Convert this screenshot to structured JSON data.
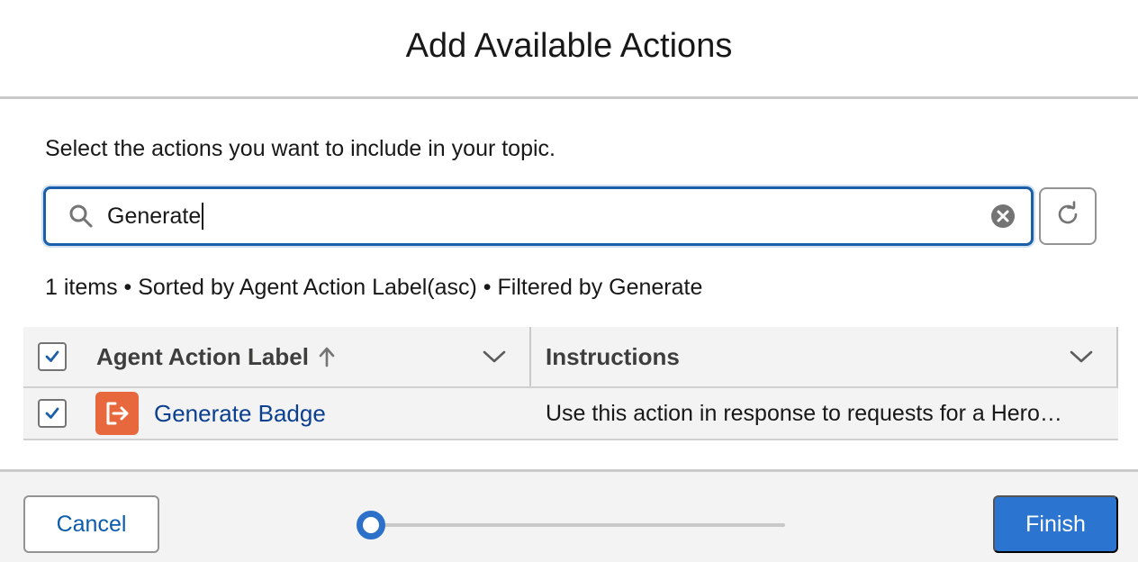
{
  "modal": {
    "title": "Add Available Actions",
    "intro": "Select the actions you want to include in your topic."
  },
  "search": {
    "value": "Generate",
    "placeholder": "Search"
  },
  "summary": "1 items • Sorted by Agent Action Label(asc) • Filtered by Generate",
  "table": {
    "columns": [
      "Agent Action Label",
      "Instructions"
    ],
    "select_all_checked": true,
    "rows": [
      {
        "label": "Generate Badge",
        "instructions": "Use this action in response to requests for a Hero…",
        "checked": true,
        "icon": "exit-arrow-icon",
        "icon_color": "#e8683e"
      }
    ]
  },
  "footer": {
    "cancel_label": "Cancel",
    "finish_label": "Finish",
    "progress_fraction": 0.0
  },
  "colors": {
    "accent": "#2b74cf",
    "link": "#0b3f8f"
  }
}
